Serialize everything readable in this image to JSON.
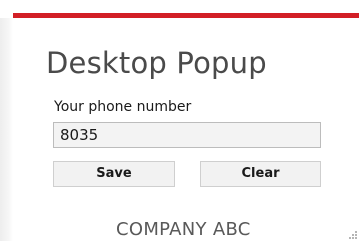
{
  "accent_color": "#d21f26",
  "popup": {
    "title": "Desktop Popup",
    "phone_label": "Your phone number",
    "phone_value": "8035",
    "save_label": "Save",
    "clear_label": "Clear",
    "company_name": "COMPANY ABC"
  }
}
